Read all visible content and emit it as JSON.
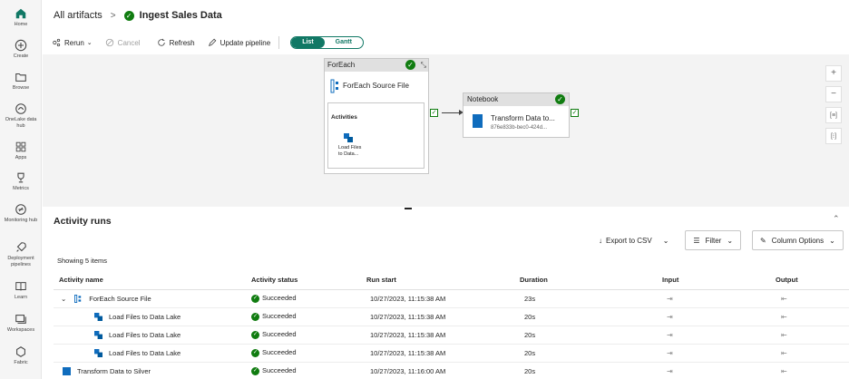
{
  "rail": {
    "items": [
      {
        "label": "Home",
        "icon": "home-icon"
      },
      {
        "label": "Create",
        "icon": "plus-circle-icon"
      },
      {
        "label": "Browse",
        "icon": "folder-icon"
      },
      {
        "label": "OneLake data hub",
        "icon": "onelake-icon"
      },
      {
        "label": "Apps",
        "icon": "apps-icon"
      },
      {
        "label": "Metrics",
        "icon": "trophy-icon"
      },
      {
        "label": "Monitoring hub",
        "icon": "monitor-icon"
      },
      {
        "label": "Deployment pipelines",
        "icon": "rocket-icon"
      },
      {
        "label": "Learn",
        "icon": "book-icon"
      },
      {
        "label": "Workspaces",
        "icon": "workspaces-icon"
      },
      {
        "label": "Fabric",
        "icon": "fabric-icon"
      }
    ]
  },
  "header": {
    "breadcrumb_link": "All artifacts",
    "separator": ">",
    "title": "Ingest Sales Data"
  },
  "toolbar": {
    "rerun": "Rerun",
    "cancel": "Cancel",
    "refresh": "Refresh",
    "update_pipeline": "Update pipeline",
    "view_list": "List",
    "view_gantt": "Gantt"
  },
  "canvas": {
    "foreach": {
      "header": "ForEach",
      "title": "ForEach Source File",
      "activities_label": "Activities",
      "child_label_1": "Load Files",
      "child_label_2": "to Data..."
    },
    "notebook": {
      "header": "Notebook",
      "title": "Transform Data to...",
      "subtitle": "876e833b-bec0-424d..."
    }
  },
  "runs": {
    "title": "Activity runs",
    "export": "Export to CSV",
    "filter": "Filter",
    "column_options": "Column Options",
    "showing": "Showing 5 items",
    "columns": {
      "name": "Activity name",
      "status": "Activity status",
      "start": "Run start",
      "duration": "Duration",
      "input": "Input",
      "output": "Output"
    },
    "rows": [
      {
        "name": "ForEach Source File",
        "status": "Succeeded",
        "start": "10/27/2023, 11:15:38 AM",
        "duration": "23s"
      },
      {
        "name": "Load Files to Data Lake",
        "status": "Succeeded",
        "start": "10/27/2023, 11:15:38 AM",
        "duration": "20s"
      },
      {
        "name": "Load Files to Data Lake",
        "status": "Succeeded",
        "start": "10/27/2023, 11:15:38 AM",
        "duration": "20s"
      },
      {
        "name": "Load Files to Data Lake",
        "status": "Succeeded",
        "start": "10/27/2023, 11:15:38 AM",
        "duration": "20s"
      },
      {
        "name": "Transform Data to Silver",
        "status": "Succeeded",
        "start": "10/27/2023, 11:16:00 AM",
        "duration": "20s"
      }
    ]
  },
  "colors": {
    "accent": "#117865",
    "success": "#107c10",
    "notebook_blue": "#0f6cbd"
  }
}
